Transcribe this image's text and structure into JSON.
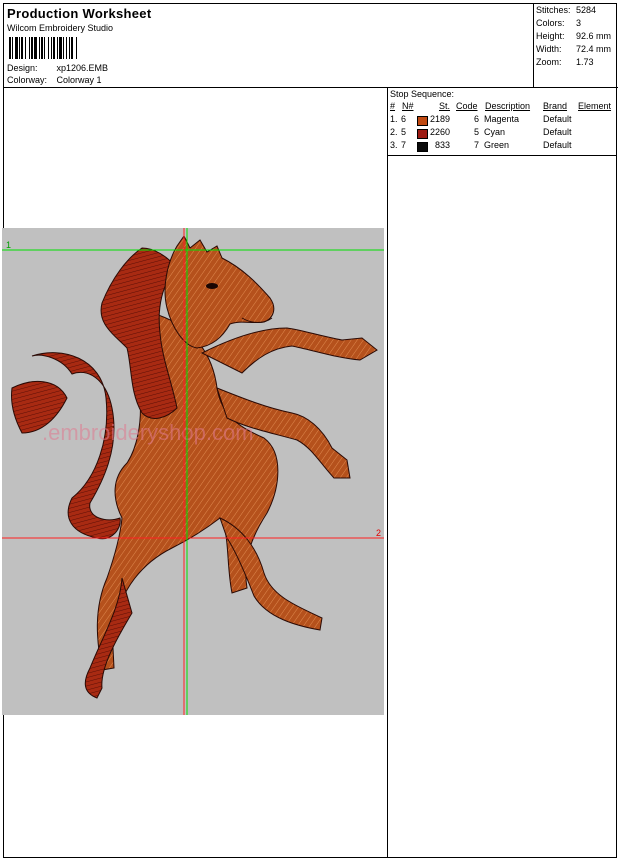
{
  "header": {
    "title": "Production Worksheet",
    "software": "Wilcom Embroidery Studio",
    "design_label": "Design:",
    "design_value": "xp1206.EMB",
    "colorway_label": "Colorway:",
    "colorway_value": "Colorway 1"
  },
  "stats": [
    {
      "label": "Stitches:",
      "value": "5284"
    },
    {
      "label": "Colors:",
      "value": "3"
    },
    {
      "label": "Height:",
      "value": "92.6 mm"
    },
    {
      "label": "Width:",
      "value": "72.4 mm"
    },
    {
      "label": "Zoom:",
      "value": "1.73"
    }
  ],
  "stop_sequence": {
    "title": "Stop Sequence:",
    "columns": [
      "#",
      "N#",
      "St.",
      "Code",
      "Description",
      "Brand",
      "Element"
    ],
    "rows": [
      {
        "num": "1.",
        "n": "6",
        "color": "#c04a12",
        "st": "2189",
        "code": "6",
        "description": "Magenta",
        "brand": "Default"
      },
      {
        "num": "2.",
        "n": "5",
        "color": "#9c1a12",
        "st": "2260",
        "code": "5",
        "description": "Cyan",
        "brand": "Default"
      },
      {
        "num": "3.",
        "n": "7",
        "color": "#0a0a0a",
        "st": "833",
        "code": "7",
        "description": "Green",
        "brand": "Default"
      }
    ]
  },
  "guides": {
    "marker_1": "1",
    "marker_2": "2"
  },
  "design": {
    "background": "#c0c0c0",
    "guide_green": "#00e000",
    "guide_red": "#ff2020",
    "body_color": "#b5511c",
    "mane_color": "#a82a12",
    "outline_color": "#2a0a05"
  }
}
